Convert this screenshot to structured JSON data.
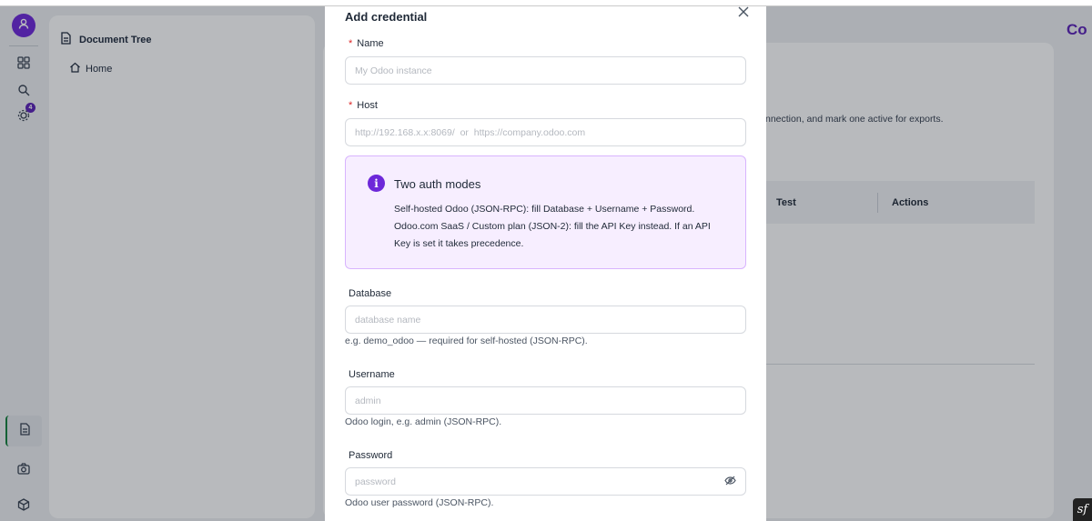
{
  "sidebar": {
    "items": [
      {
        "icon": "user-icon"
      },
      {
        "icon": "grid-icon"
      },
      {
        "icon": "search-icon"
      },
      {
        "icon": "integrations-icon",
        "badge": "4"
      },
      {
        "icon": "document-icon"
      },
      {
        "icon": "camera-icon"
      },
      {
        "icon": "cube-icon"
      }
    ]
  },
  "tree": {
    "title": "Document Tree",
    "home_label": "Home"
  },
  "main": {
    "description_fragment": "nnection, and mark one active for exports.",
    "table": {
      "columns": [
        "Test",
        "Actions"
      ]
    },
    "brand_fragment": "Co"
  },
  "modal": {
    "title": "Add credential",
    "fields": {
      "name": {
        "label": "Name",
        "placeholder": "My Odoo instance",
        "required": true
      },
      "host": {
        "label": "Host",
        "placeholder": "http://192.168.x.x:8069/  or  https://company.odoo.com",
        "required": true
      },
      "database": {
        "label": "Database",
        "placeholder": "database name",
        "hint": "e.g. demo_odoo — required for self-hosted (JSON-RPC)."
      },
      "username": {
        "label": "Username",
        "placeholder": "admin",
        "hint": "Odoo login, e.g. admin (JSON-RPC)."
      },
      "password": {
        "label": "Password",
        "placeholder": "password",
        "hint": "Odoo user password (JSON-RPC)."
      }
    },
    "info": {
      "title": "Two auth modes",
      "line1": "Self-hosted Odoo (JSON-RPC): fill Database + Username + Password.",
      "line2": "Odoo.com SaaS / Custom plan (JSON-2): fill the API Key instead. If an API Key is set it takes precedence."
    }
  },
  "colors": {
    "accent": "#6d28d9",
    "info_bg": "#f7eeff",
    "info_border": "#d8b4fe",
    "required": "#dc2626"
  }
}
